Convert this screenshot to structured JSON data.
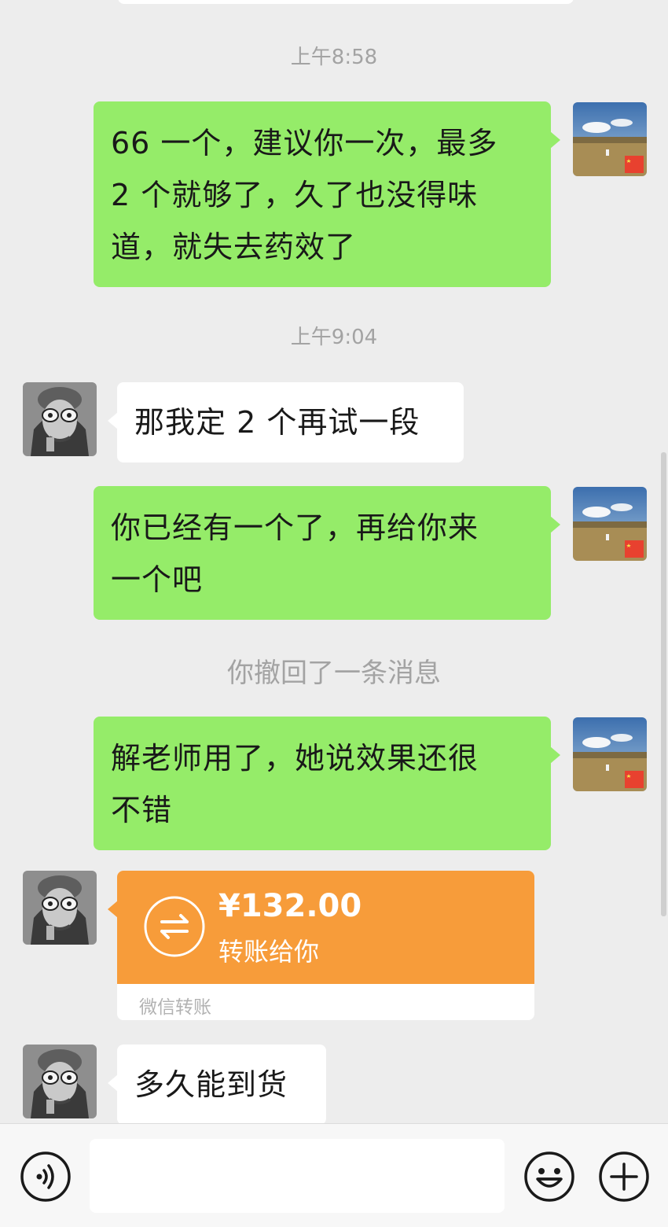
{
  "chat": {
    "timestamps": [
      "上午8:58",
      "上午9:04"
    ],
    "messages": {
      "m1": "66 一个，建议你一次，最多 2 个就够了，久了也没得味道，就失去药效了",
      "m1_lines": [
        "66 一个，建议你一次，最多",
        "2 个就够了，久了也没得味",
        "道，就失去药效了"
      ],
      "m2": "那我定 2 个再试一段",
      "m3_lines": [
        "你已经有一个了，再给你来",
        "一个吧"
      ],
      "recall_notice": "你撤回了一条消息",
      "m4_lines": [
        "解老师用了，她说效果还很",
        "不错"
      ],
      "m5": "多久能到货"
    },
    "transfer": {
      "amount": "¥132.00",
      "description": "转账给你",
      "footer": "微信转账",
      "color": "#f79c3a"
    }
  },
  "input_bar": {
    "voice_icon": "voice-icon",
    "emoji_icon": "emoji-icon",
    "plus_icon": "plus-icon",
    "input_value": ""
  },
  "colors": {
    "self_bubble": "#95ec69",
    "other_bubble": "#ffffff",
    "background": "#ededed"
  }
}
